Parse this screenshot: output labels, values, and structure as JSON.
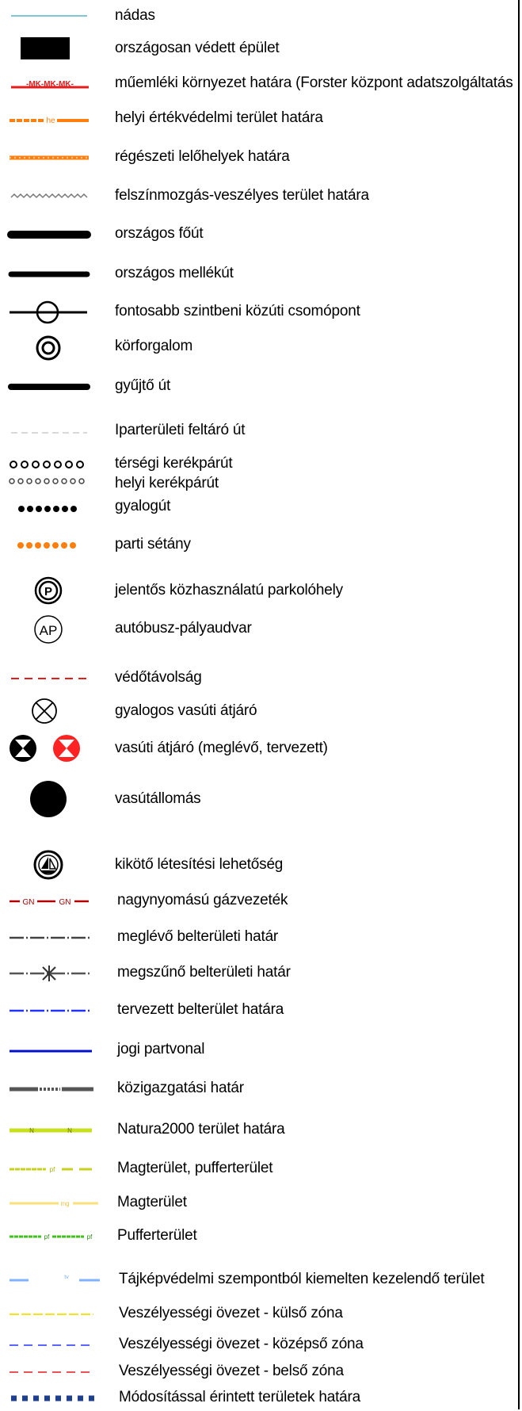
{
  "legend": {
    "items": [
      {
        "label": "nádas",
        "icon": "reed-line-icon"
      },
      {
        "label": "országosan védett épület",
        "icon": "protected-building-icon"
      },
      {
        "label": "műemléki környezet határa (Forster központ adatszolgáltatás",
        "icon": "monument-boundary-icon",
        "symbol_text": "-MK-MK-MK-"
      },
      {
        "label": "helyi értékvédelmi terület határa",
        "icon": "local-value-boundary-icon",
        "symbol_text": "he"
      },
      {
        "label": "régészeti lelőhelyek határa",
        "icon": "archaeological-boundary-icon"
      },
      {
        "label": "felszínmozgás-veszélyes terület határa",
        "icon": "landslide-zone-icon"
      },
      {
        "label": "országos főút",
        "icon": "main-road-icon"
      },
      {
        "label": "országos mellékút",
        "icon": "secondary-road-icon"
      },
      {
        "label": "fontosabb szintbeni közúti csomópont",
        "icon": "road-junction-icon"
      },
      {
        "label": "körforgalom",
        "icon": "roundabout-icon"
      },
      {
        "label": "gyűjtő út",
        "icon": "collector-road-icon"
      },
      {
        "label": "Iparterületi feltáró út",
        "icon": "industrial-access-road-icon"
      },
      {
        "label": "térségi kerékpárút",
        "icon": "regional-bike-path-icon"
      },
      {
        "label": "helyi kerékpárút",
        "icon": "local-bike-path-icon"
      },
      {
        "label": "gyalogút",
        "icon": "footpath-icon"
      },
      {
        "label": "parti sétány",
        "icon": "promenade-icon"
      },
      {
        "label": "jelentős közhasználatú parkolóhely",
        "icon": "parking-icon",
        "symbol_text": "P"
      },
      {
        "label": "autóbusz-pályaudvar",
        "icon": "bus-station-icon",
        "symbol_text": "AP"
      },
      {
        "label": "védőtávolság",
        "icon": "protection-distance-icon"
      },
      {
        "label": "gyalogos vasúti átjáró",
        "icon": "pedestrian-rail-crossing-icon"
      },
      {
        "label": "vasúti átjáró (meglévő, tervezett)",
        "icon": "rail-crossing-icon"
      },
      {
        "label": "vasútállomás",
        "icon": "railway-station-icon"
      },
      {
        "label": "kikötő létesítési lehetőség",
        "icon": "harbor-icon"
      },
      {
        "label": "nagynyomású gázvezeték",
        "icon": "gas-pipeline-icon",
        "symbol_text": "GN"
      },
      {
        "label": "meglévő belterületi határ",
        "icon": "existing-inner-boundary-icon"
      },
      {
        "label": "megszűnő belterületi határ",
        "icon": "ceasing-inner-boundary-icon"
      },
      {
        "label": "tervezett belterület határa",
        "icon": "planned-inner-boundary-icon"
      },
      {
        "label": "jogi partvonal",
        "icon": "legal-shoreline-icon"
      },
      {
        "label": "közigazgatási határ",
        "icon": "administrative-boundary-icon"
      },
      {
        "label": "Natura2000 terület határa",
        "icon": "natura2000-boundary-icon",
        "symbol_text": "N"
      },
      {
        "label": "Magterület, pufferterület",
        "icon": "core-buffer-area-icon",
        "symbol_text": "pf"
      },
      {
        "label": "Magterület",
        "icon": "core-area-icon",
        "symbol_text": "mg"
      },
      {
        "label": "Pufferterület",
        "icon": "buffer-area-icon",
        "symbol_text": "pf"
      },
      {
        "label": "Tájképvédelmi szempontból kiemelten kezelendő terület",
        "icon": "landscape-protection-icon",
        "symbol_text": "tv"
      },
      {
        "label": "Veszélyességi övezet - külső zóna",
        "icon": "danger-zone-outer-icon"
      },
      {
        "label": "Veszélyességi övezet - középső zóna",
        "icon": "danger-zone-middle-icon"
      },
      {
        "label": "Veszélyességi övezet - belső zóna",
        "icon": "danger-zone-inner-icon"
      },
      {
        "label": "Módosítással érintett területek határa",
        "icon": "modified-area-boundary-icon"
      }
    ]
  },
  "colors": {
    "text": "#000000",
    "red": "#e41c1c",
    "orange": "#ff7f0e",
    "dark_red": "#b00000",
    "blue": "#2233ff",
    "navy": "#0011cc",
    "lime": "#c8e01e",
    "yellow": "#f2e51e",
    "pale_yellow": "#fbe07a",
    "green": "#3ec21a",
    "light_blue": "#7fb3ff",
    "gray": "#555555"
  }
}
